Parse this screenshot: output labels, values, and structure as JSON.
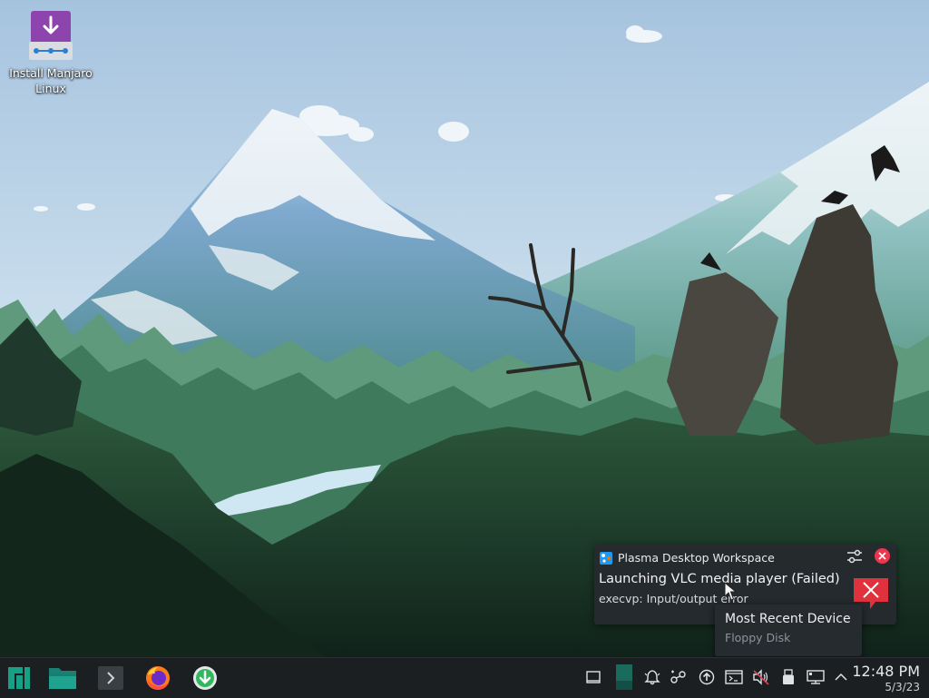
{
  "desktop": {
    "icons": [
      {
        "label": "Install Manjaro Linux",
        "icon": "install-manjaro-icon"
      }
    ]
  },
  "notification": {
    "app_name": "Plasma Desktop Workspace",
    "title": "Launching VLC media player (Failed)",
    "body": "execvp: Input/output error",
    "app_icon": "plasma-icon",
    "status_icon": "error-icon",
    "close_color": "#e8384f",
    "error_color": "#e0323c"
  },
  "tooltip": {
    "title": "Most Recent Device",
    "subtitle": "Floppy Disk"
  },
  "taskbar": {
    "items": [
      {
        "name": "manjaro-menu-icon"
      },
      {
        "name": "file-manager-icon"
      },
      {
        "name": "terminal-icon"
      },
      {
        "name": "firefox-icon"
      },
      {
        "name": "installer-icon"
      }
    ],
    "tray": [
      {
        "name": "show-desktop-icon"
      },
      {
        "name": "virtual-desktop-icon"
      },
      {
        "name": "notifications-icon"
      },
      {
        "name": "network-icon"
      },
      {
        "name": "updates-icon"
      },
      {
        "name": "console-icon"
      },
      {
        "name": "volume-muted-icon"
      },
      {
        "name": "removable-device-icon"
      },
      {
        "name": "display-icon"
      },
      {
        "name": "tray-expand-icon"
      }
    ],
    "accent": "#16a085"
  },
  "clock": {
    "time": "12:48 PM",
    "date": "5/3/23"
  }
}
